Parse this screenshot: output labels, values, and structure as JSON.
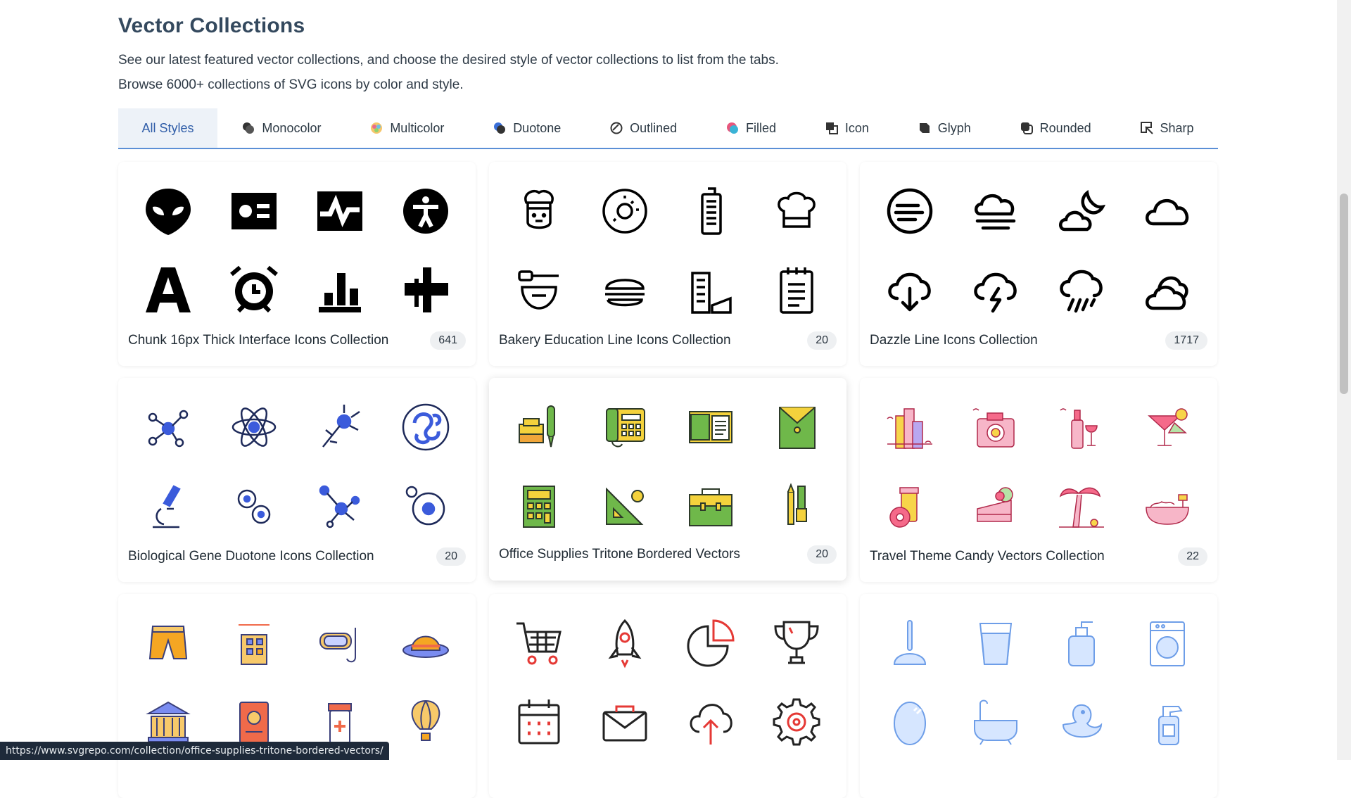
{
  "page": {
    "title": "Vector Collections",
    "description_line1": "See our latest featured vector collections, and choose the desired style of vector collections to list from the tabs.",
    "description_line2": "Browse 6000+ collections of SVG icons by color and style."
  },
  "tabs": [
    {
      "label": "All Styles",
      "icon": "none",
      "active": true
    },
    {
      "label": "Monocolor",
      "icon": "monocolor-icon"
    },
    {
      "label": "Multicolor",
      "icon": "multicolor-icon"
    },
    {
      "label": "Duotone",
      "icon": "duotone-icon"
    },
    {
      "label": "Outlined",
      "icon": "outlined-icon"
    },
    {
      "label": "Filled",
      "icon": "filled-icon"
    },
    {
      "label": "Icon",
      "icon": "icon-style-icon"
    },
    {
      "label": "Glyph",
      "icon": "glyph-icon"
    },
    {
      "label": "Rounded",
      "icon": "rounded-icon"
    },
    {
      "label": "Sharp",
      "icon": "sharp-icon"
    }
  ],
  "collections": [
    {
      "title": "Chunk 16px Thick Interface Icons Collection",
      "count": "641",
      "icons": [
        "alien-icon",
        "id-card-icon",
        "pulse-icon",
        "accessibility-icon",
        "letter-a-icon",
        "alarm-clock-icon",
        "bar-chart-icon",
        "align-icon"
      ]
    },
    {
      "title": "Bakery Education Line Icons Collection",
      "count": "20",
      "icons": [
        "chef-icon",
        "donut-icon",
        "building-icon",
        "chef-hat-icon",
        "honey-bowl-icon",
        "burger-icon",
        "buildings-cheese-icon",
        "notepad-icon"
      ]
    },
    {
      "title": "Dazzle Line Icons Collection",
      "count": "1717",
      "icons": [
        "wind-circle-icon",
        "fog-cloud-icon",
        "moon-cloud-icon",
        "cloud-icon",
        "cloud-download-icon",
        "cloud-lightning-icon",
        "cloud-rain-icon",
        "clouds-icon"
      ]
    },
    {
      "title": "Biological Gene Duotone Icons Collection",
      "count": "20",
      "icons": [
        "molecule-icon",
        "atom-icon",
        "neuron-icon",
        "dna-swirl-icon",
        "microscope-icon",
        "cells-icon",
        "molecule-network-icon",
        "cell-icon"
      ]
    },
    {
      "title": "Office Supplies Tritone Bordered Vectors",
      "count": "20",
      "icons": [
        "ink-pen-icon",
        "telephone-icon",
        "folder-docs-icon",
        "envelope-folder-icon",
        "calculator-icon",
        "set-square-icon",
        "briefcase-icon",
        "pencils-icon"
      ]
    },
    {
      "title": "Travel Theme Candy Vectors Collection",
      "count": "22",
      "icons": [
        "city-icon",
        "camera-icon",
        "wine-icon",
        "cocktail-icon",
        "coffee-donut-icon",
        "cake-icon",
        "palm-tree-icon",
        "bathtub-icon"
      ]
    },
    {
      "title": "",
      "count": "",
      "icons": [
        "shorts-icon",
        "hotel-icon",
        "snorkel-icon",
        "sun-hat-icon",
        "museum-icon",
        "passport-icon",
        "medicine-icon",
        "hot-air-balloon-icon"
      ]
    },
    {
      "title": "",
      "count": "",
      "icons": [
        "shopping-cart-icon",
        "rocket-icon",
        "pie-chart-icon",
        "trophy-icon",
        "calendar-icon",
        "envelope-icon",
        "cloud-upload-icon",
        "settings-gear-icon"
      ]
    },
    {
      "title": "",
      "count": "",
      "icons": [
        "plunger-icon",
        "glass-icon",
        "soap-dispenser-icon",
        "washing-machine-icon",
        "mirror-icon",
        "bathtub-icon",
        "rubber-duck-icon",
        "spray-bottle-icon"
      ]
    }
  ],
  "status_url": "https://www.svgrepo.com/collection/office-supplies-tritone-bordered-vectors/"
}
